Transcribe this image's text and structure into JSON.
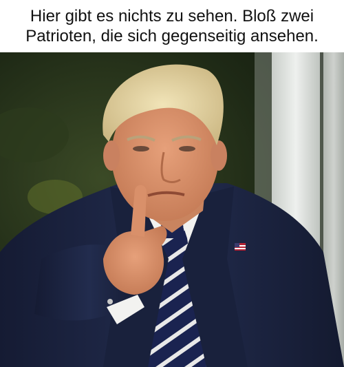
{
  "caption": {
    "line1": "Hier gibt es nichts zu sehen. Bloß zwei",
    "line2": "Patrioten, die sich gegenseitig ansehen."
  },
  "photo": {
    "description_icon": "man-pointing-photo",
    "colors": {
      "background_foliage": "#1f2a16",
      "background_pillar": "#d9ddd9",
      "suit": "#1c2440",
      "shirt": "#f2f2f0",
      "tie_dark": "#1a2350",
      "tie_stripe": "#e8e8e8",
      "skin": "#d9906a",
      "hair": "#e8d9a8",
      "flag_pin": "#b22234"
    }
  }
}
